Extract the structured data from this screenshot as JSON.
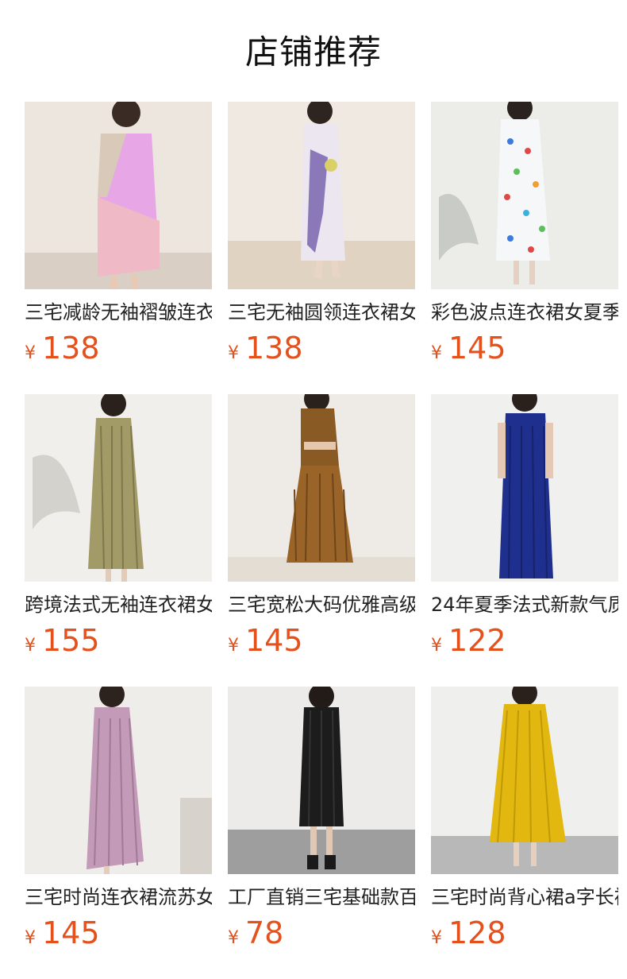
{
  "header": {
    "title": "店铺推荐"
  },
  "currency_symbol": "¥",
  "colors": {
    "price": "#e5511d"
  },
  "products": [
    {
      "name": "三宅减龄无袖褶皱连衣裙",
      "price": "138"
    },
    {
      "name": "三宅无袖圆领连衣裙女",
      "price": "138"
    },
    {
      "name": "彩色波点连衣裙女夏季",
      "price": "145"
    },
    {
      "name": "跨境法式无袖连衣裙女",
      "price": "155"
    },
    {
      "name": "三宅宽松大码优雅高级",
      "price": "145"
    },
    {
      "name": "24年夏季法式新款气质",
      "price": "122"
    },
    {
      "name": "三宅时尚连衣裙流苏女",
      "price": "145"
    },
    {
      "name": "工厂直销三宅基础款百",
      "price": "78"
    },
    {
      "name": "三宅时尚背心裙a字长裙",
      "price": "128"
    }
  ]
}
